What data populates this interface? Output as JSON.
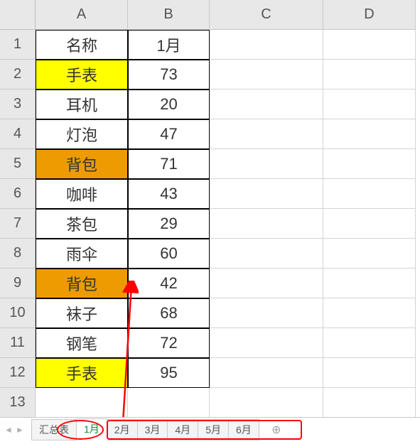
{
  "columns": [
    "A",
    "B",
    "C",
    "D"
  ],
  "row_numbers": [
    "1",
    "2",
    "3",
    "4",
    "5",
    "6",
    "7",
    "8",
    "9",
    "10",
    "11",
    "12",
    "13"
  ],
  "header": {
    "a": "名称",
    "b": "1月"
  },
  "rows": [
    {
      "name": "手表",
      "val": "73",
      "hl": "yellow"
    },
    {
      "name": "耳机",
      "val": "20",
      "hl": ""
    },
    {
      "name": "灯泡",
      "val": "47",
      "hl": ""
    },
    {
      "name": "背包",
      "val": "71",
      "hl": "orange"
    },
    {
      "name": "咖啡",
      "val": "43",
      "hl": ""
    },
    {
      "name": "茶包",
      "val": "29",
      "hl": ""
    },
    {
      "name": "雨伞",
      "val": "60",
      "hl": ""
    },
    {
      "name": "背包",
      "val": "42",
      "hl": "orange"
    },
    {
      "name": "袜子",
      "val": "68",
      "hl": ""
    },
    {
      "name": "钢笔",
      "val": "72",
      "hl": ""
    },
    {
      "name": "手表",
      "val": "95",
      "hl": "yellow"
    }
  ],
  "tabs": {
    "summary": "汇总表",
    "items": [
      "1月",
      "2月",
      "3月",
      "4月",
      "5月",
      "6月"
    ],
    "active_index": 0
  },
  "chart_data": {
    "type": "table",
    "title": "1月",
    "columns": [
      "名称",
      "1月"
    ],
    "data": [
      [
        "手表",
        73
      ],
      [
        "耳机",
        20
      ],
      [
        "灯泡",
        47
      ],
      [
        "背包",
        71
      ],
      [
        "咖啡",
        43
      ],
      [
        "茶包",
        29
      ],
      [
        "雨伞",
        60
      ],
      [
        "背包",
        42
      ],
      [
        "袜子",
        68
      ],
      [
        "钢笔",
        72
      ],
      [
        "手表",
        95
      ]
    ]
  }
}
